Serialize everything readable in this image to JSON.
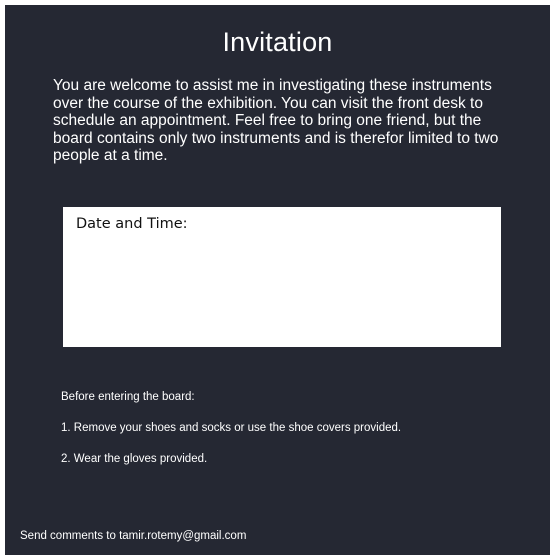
{
  "invitation": {
    "title": "Invitation",
    "intro": "You are welcome to assist me in investigating these instruments over the course of the exhibition. You can visit the front desk to schedule an appointment. Feel free to bring one friend, but the board contains only two instruments and is therefor limited to two people at a time.",
    "date_label": "Date and Time:",
    "instructions": {
      "heading": "Before entering the board:",
      "item_1": "1. Remove your shoes and socks or use the shoe covers provided.",
      "item_2": "2.  Wear the gloves provided."
    },
    "footer": "Send comments to tamir.rotemy@gmail.com"
  }
}
